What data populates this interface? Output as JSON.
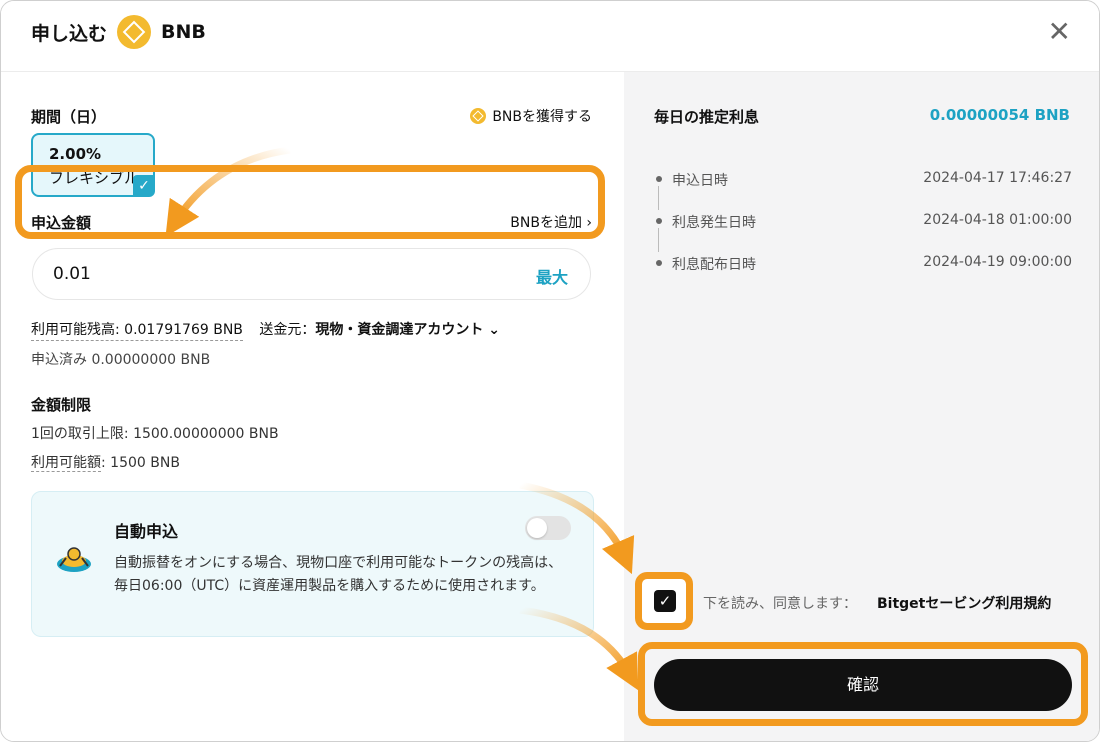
{
  "header": {
    "title": "申し込む",
    "coin": "BNB",
    "close_icon": "close-icon"
  },
  "left": {
    "period_label": "期間（日）",
    "earn_link": "BNBを獲得する",
    "period_card": {
      "rate": "2.00%",
      "type": "フレキシブル"
    },
    "amount_label": "申込金額",
    "add_link": "BNBを追加 ›",
    "amount_value": "0.01",
    "max_label": "最大",
    "balance_label": "利用可能残高: 0.01791769 BNB",
    "from_prefix": "送金元：",
    "from_value": "現物・資金調達アカウント ⌄",
    "subscribed": "申込済み 0.00000000 BNB",
    "limits_title": "金額制限",
    "limit_per_tx": "1回の取引上限: 1500.00000000 BNB",
    "limit_available_label": "利用可能額",
    "limit_available_value": ": 1500 BNB",
    "auto": {
      "title": "自動申込",
      "description": "自動振替をオンにする場合、現物口座で利用可能なトークンの残高は、毎日06:00（UTC）に資産運用製品を購入するために使用されます。",
      "enabled": false
    }
  },
  "right": {
    "est_label": "毎日の推定利息",
    "est_value": "0.00000054 BNB",
    "timeline": [
      {
        "label": "申込日時",
        "date": "2024-04-17 17:46:27"
      },
      {
        "label": "利息発生日時",
        "date": "2024-04-18 01:00:00"
      },
      {
        "label": "利息配布日時",
        "date": "2024-04-19 09:00:00"
      }
    ],
    "agree_text": "下を読み、同意します：",
    "agree_link": "Bitgetセービング利用規約",
    "agree_checked": true,
    "confirm_label": "確認"
  },
  "colors": {
    "accent": "#1da2c3",
    "bnb": "#f3ba2f",
    "highlight": "#f29a1f",
    "primary_button": "#111111"
  }
}
